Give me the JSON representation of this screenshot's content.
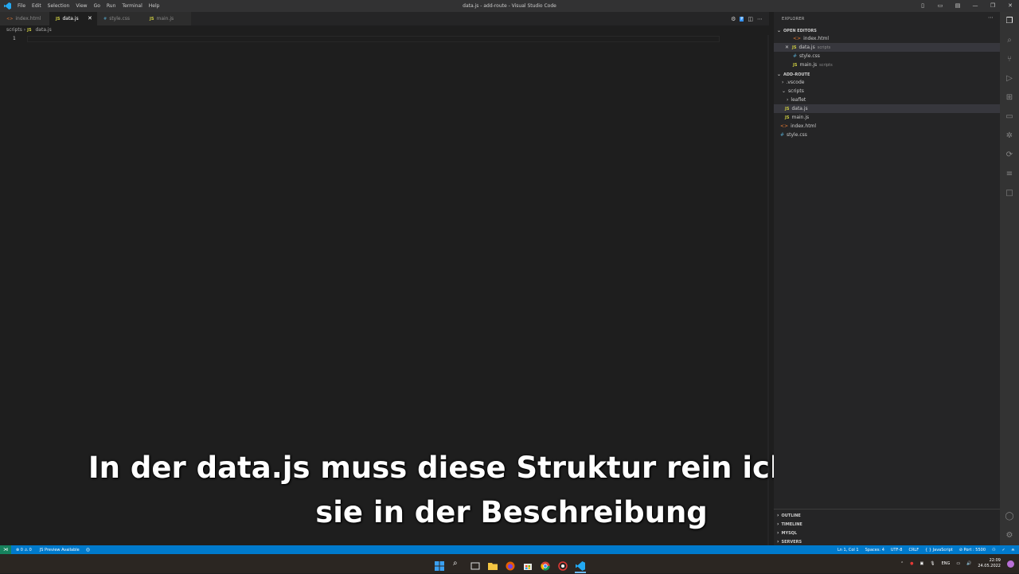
{
  "titlebar": {
    "menu": [
      "File",
      "Edit",
      "Selection",
      "View",
      "Go",
      "Run",
      "Terminal",
      "Help"
    ],
    "title": "data.js - add-route - Visual Studio Code"
  },
  "tabs": [
    {
      "label": "index.html",
      "type": "html"
    },
    {
      "label": "data.js",
      "type": "js"
    },
    {
      "label": "style.css",
      "type": "css"
    },
    {
      "label": "main.js",
      "type": "js"
    }
  ],
  "breadcrumb": {
    "folder": "scripts",
    "file": "data.js"
  },
  "editor": {
    "line_number": "1"
  },
  "subtitle": {
    "line1": "In der data.js muss diese Struktur rein ich verlinke",
    "line2": "sie in der Beschreibung"
  },
  "explorer": {
    "header": "EXPLORER",
    "open_editors_title": "OPEN EDITORS",
    "open_editors": [
      {
        "name": "index.html",
        "desc": "",
        "type": "html"
      },
      {
        "name": "data.js",
        "desc": "scripts",
        "type": "js"
      },
      {
        "name": "style.css",
        "desc": "",
        "type": "css"
      },
      {
        "name": "main.js",
        "desc": "scripts",
        "type": "js"
      }
    ],
    "workspace_title": "ADD-ROUTE",
    "tree": [
      {
        "name": ".vscode",
        "kind": "folder"
      },
      {
        "name": "scripts",
        "kind": "folder-open"
      },
      {
        "name": "leaflet",
        "kind": "folder"
      },
      {
        "name": "data.js",
        "kind": "js"
      },
      {
        "name": "main.js",
        "kind": "js"
      },
      {
        "name": "index.html",
        "kind": "html"
      },
      {
        "name": "style.css",
        "kind": "css"
      }
    ],
    "bottom_sections": [
      "OUTLINE",
      "TIMELINE",
      "MYSQL",
      "SERVERS"
    ]
  },
  "statusbar": {
    "problems": "⊗ 0 ⚠ 0",
    "preview": "JS Preview Available",
    "position": "Ln 1, Col 1",
    "spaces": "Spaces: 4",
    "encoding": "UTF-8",
    "eol": "CRLF",
    "language": "{ } JavaScript",
    "port": "⊘ Port : 5500"
  },
  "taskbar": {
    "lang": "ENG",
    "time": "22:09",
    "date": "24.05.2022"
  },
  "colors": {
    "statusbar": "#007acc",
    "editor_bg": "#1e1e1e",
    "sidebar_bg": "#252526",
    "js_icon": "#cbcb41",
    "css_icon": "#519aba",
    "html_icon": "#e37933"
  }
}
